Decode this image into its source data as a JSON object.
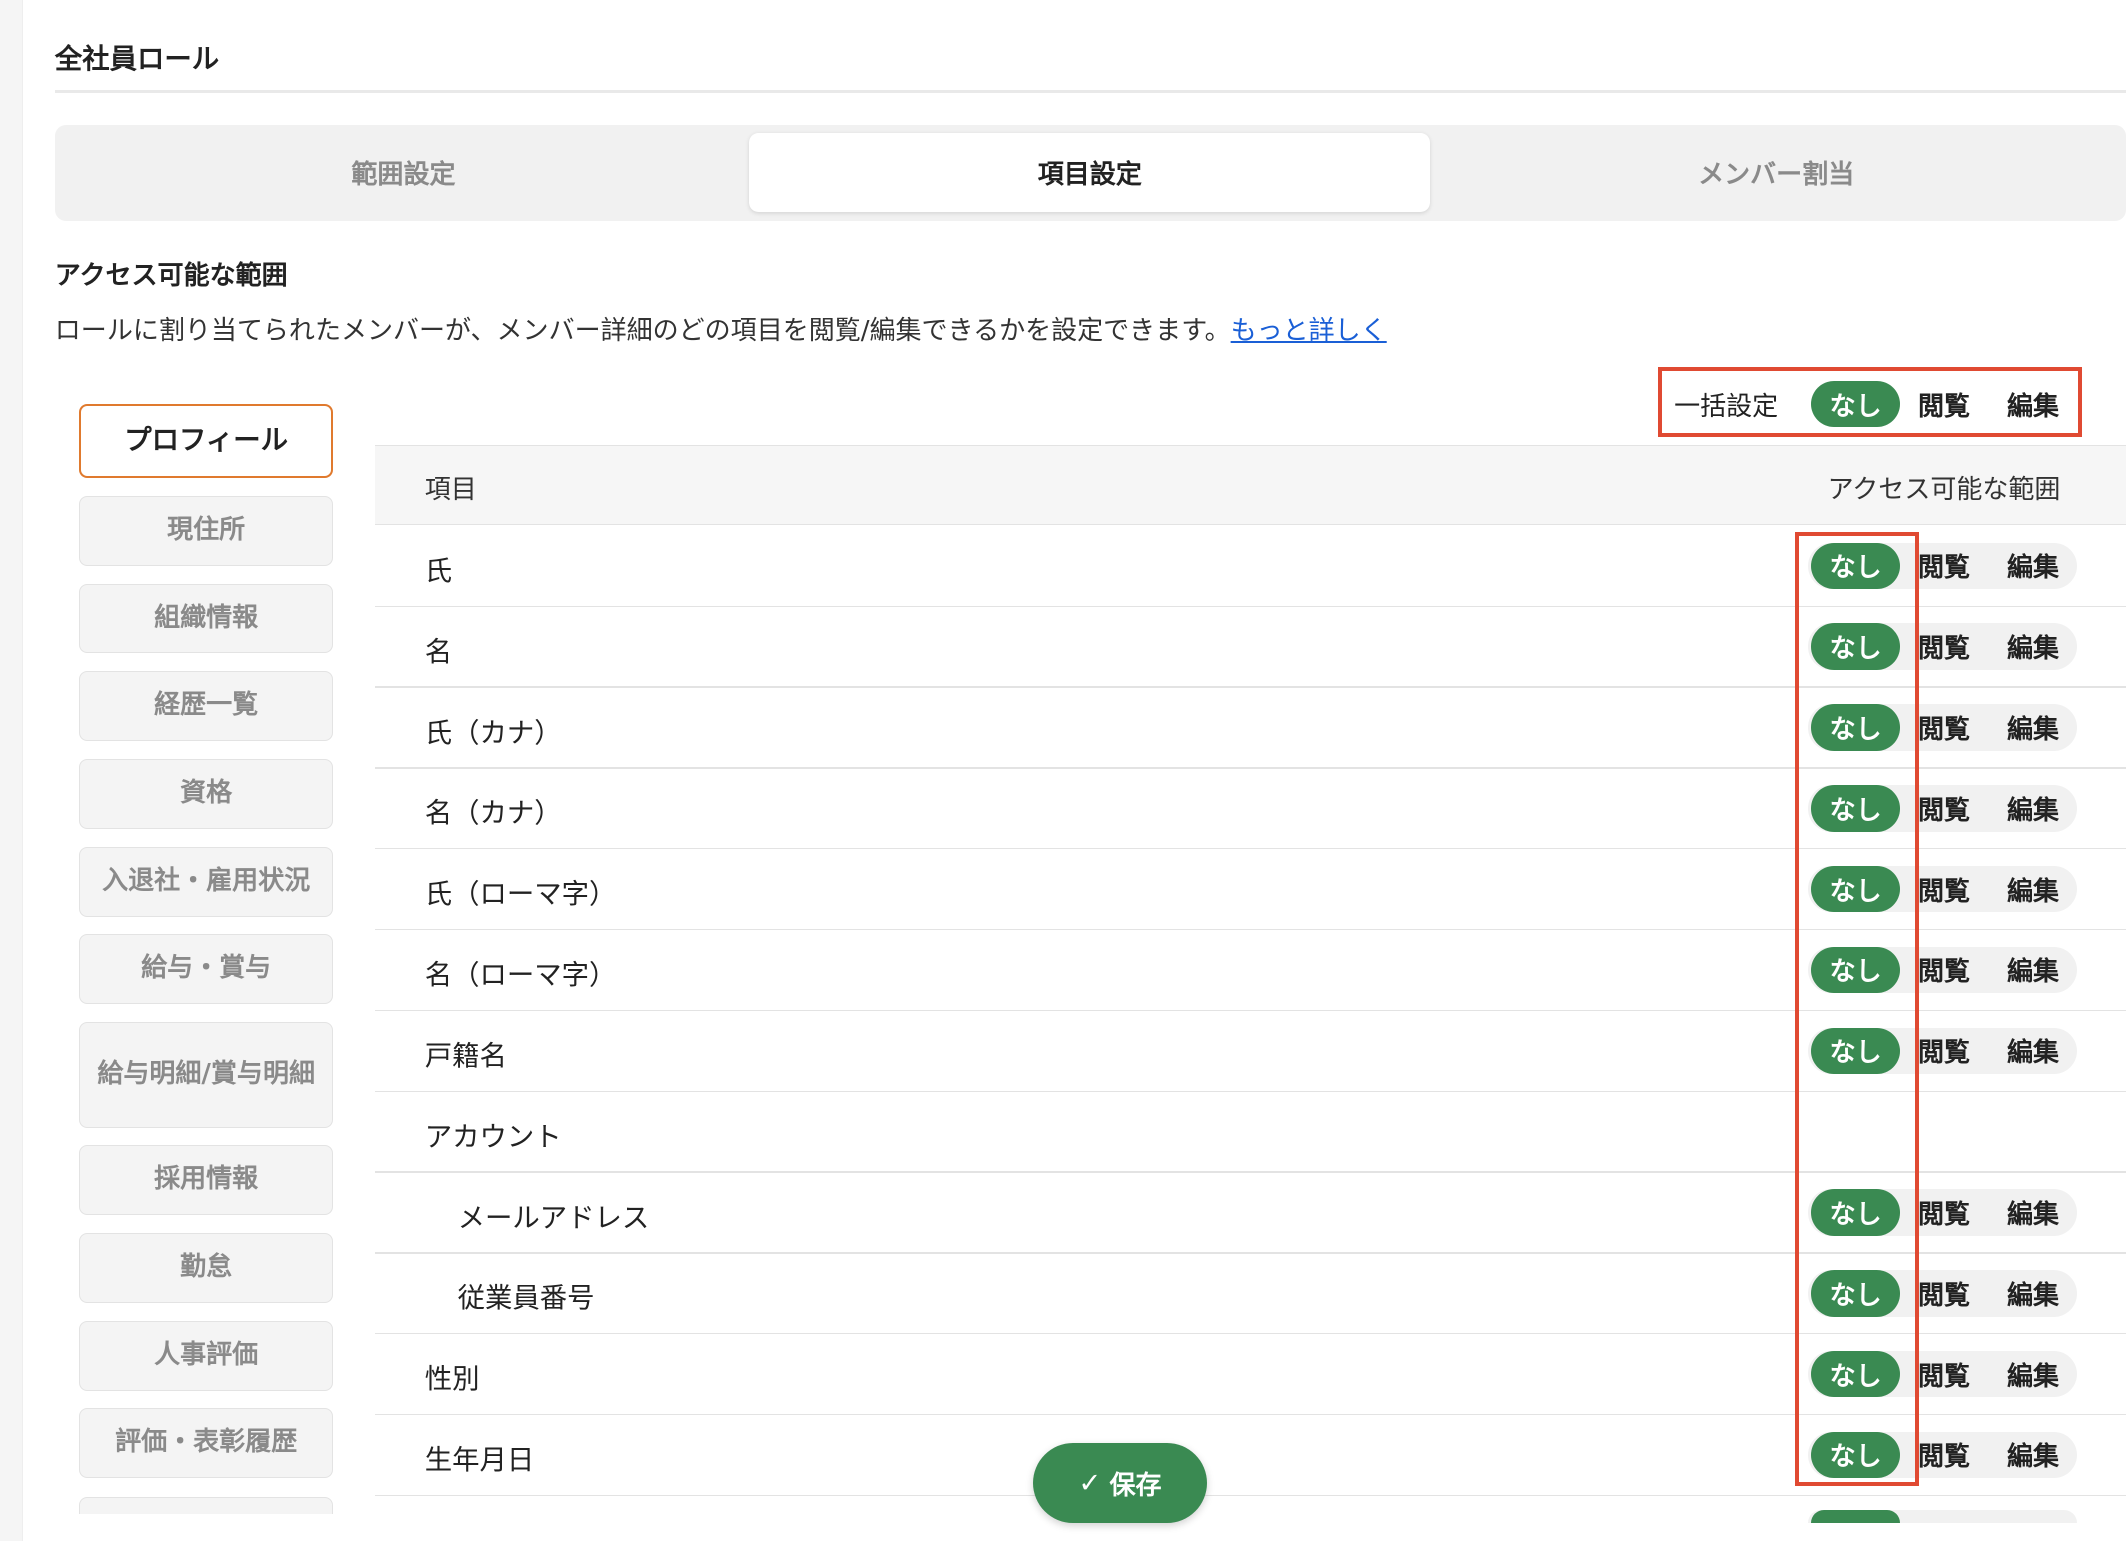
{
  "page_title": "全社員ロール",
  "tabs": [
    "範囲設定",
    "項目設定",
    "メンバー割当"
  ],
  "active_tab": 1,
  "section": {
    "title": "アクセス可能な範囲",
    "description": "ロールに割り当てられたメンバーが、メンバー詳細のどの項目を閲覧/編集できるかを設定できます。",
    "more_link": "もっと詳しく"
  },
  "categories": [
    "プロフィール",
    "現住所",
    "組織情報",
    "経歴一覧",
    "資格",
    "入退社・雇用状況",
    "給与・賞与",
    "給与明細/賞与明細",
    "採用情報",
    "勤怠",
    "人事評価",
    "評価・表彰履歴"
  ],
  "active_category": 0,
  "bulk": {
    "label": "一括設定",
    "options": [
      "なし",
      "閲覧",
      "編集"
    ],
    "selected": "なし"
  },
  "table": {
    "header_item": "項目",
    "header_range": "アクセス可能な範囲",
    "rows": [
      {
        "label": "氏",
        "value": "なし"
      },
      {
        "label": "名",
        "value": "なし"
      },
      {
        "label": "氏（カナ）",
        "value": "なし"
      },
      {
        "label": "名（カナ）",
        "value": "なし"
      },
      {
        "label": "氏（ローマ字）",
        "value": "なし"
      },
      {
        "label": "名（ローマ字）",
        "value": "なし"
      },
      {
        "label": "戸籍名",
        "value": "なし"
      },
      {
        "label": "アカウント",
        "group": true
      },
      {
        "label": "メールアドレス",
        "value": "なし",
        "indent": true
      },
      {
        "label": "従業員番号",
        "value": "なし",
        "indent": true
      },
      {
        "label": "性別",
        "value": "なし"
      },
      {
        "label": "生年月日",
        "value": "なし"
      }
    ]
  },
  "save_label": "保存",
  "colors": {
    "accent": "#3a8a52",
    "highlight": "#e04a32",
    "active_tab_border": "#e07a2e"
  }
}
